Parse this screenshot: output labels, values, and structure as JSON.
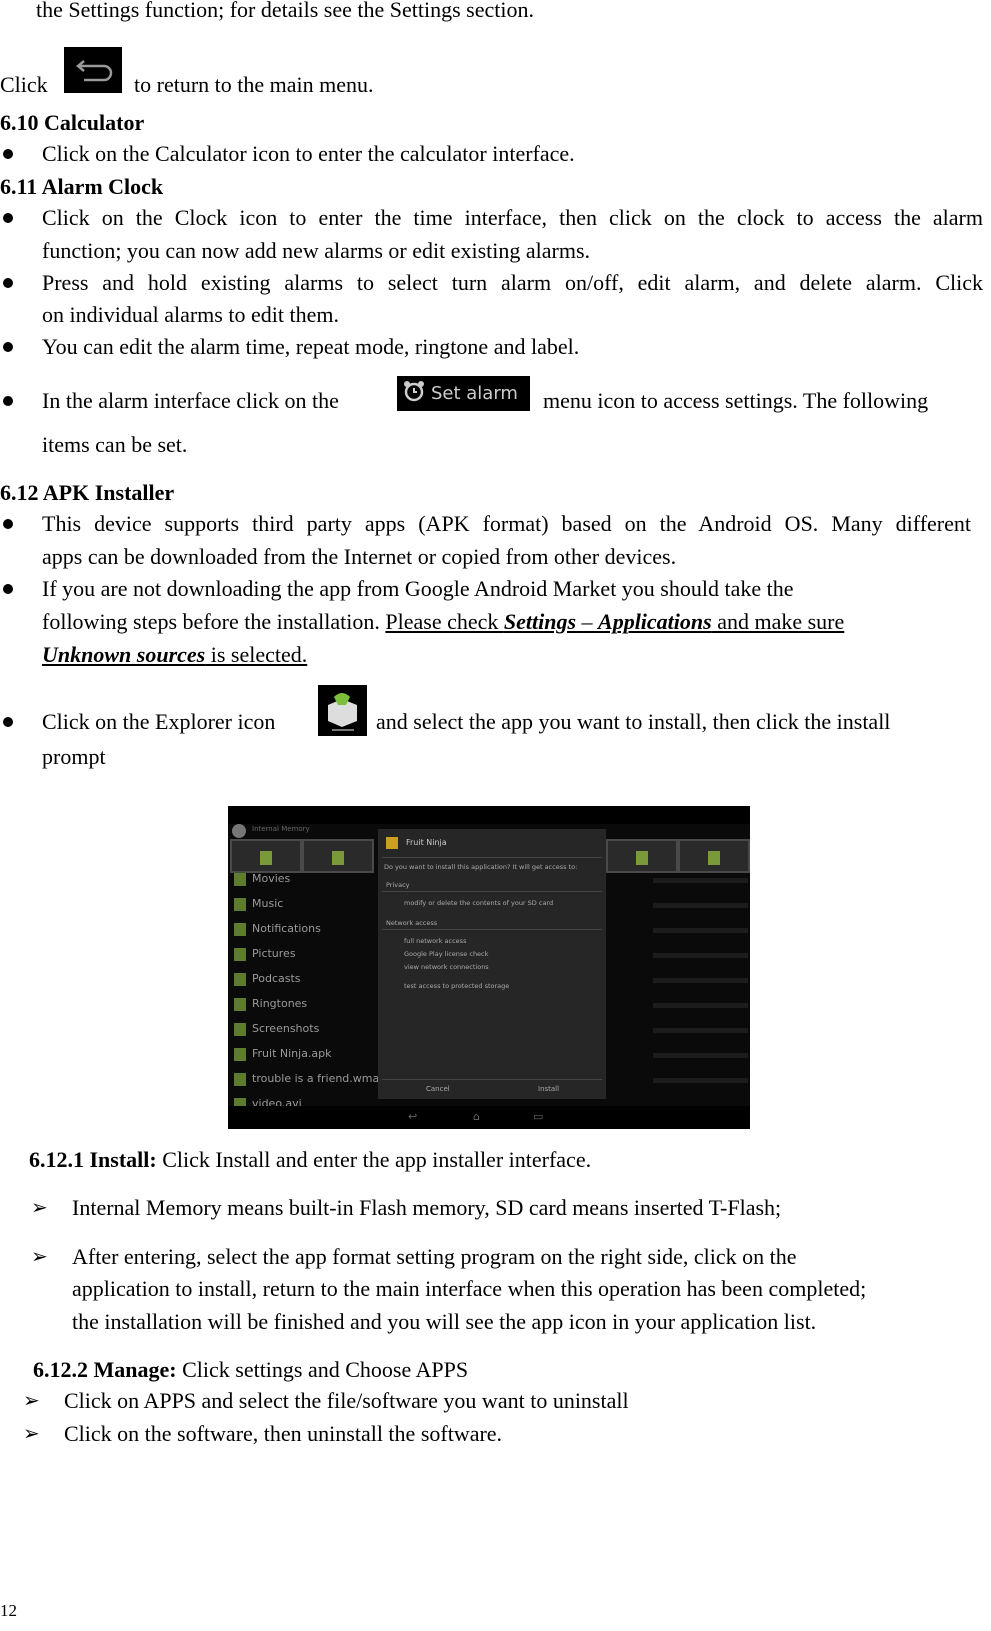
{
  "intro_line": "the Settings function; for details see the Settings section.",
  "back_line": {
    "before": "Click",
    "after": "to return to the main menu.",
    "icon": "back-arrow-icon"
  },
  "s610": {
    "heading": "6.10 Calculator",
    "bullets": [
      "Click on the Calculator icon to enter the calculator interface."
    ]
  },
  "s611": {
    "heading": "6.11 Alarm Clock",
    "b1": [
      "Click on the Clock icon to enter the time interface, then click on the clock to access the alarm",
      "function; you can now add new alarms or edit existing alarms."
    ],
    "b2": [
      "Press and hold existing alarms to select turn alarm on/off, edit alarm, and delete alarm. Click",
      "on individual alarms to edit them."
    ],
    "b3": "You can edit the alarm time, repeat mode, ringtone and label.",
    "b4": {
      "before": "In the alarm interface click on the",
      "after": "menu icon to access settings. The following",
      "line2": "items can be set.",
      "button_label": "Set alarm",
      "icon": "alarm-clock-icon"
    }
  },
  "s612": {
    "heading": "6.12 APK Installer",
    "b1": [
      "This device supports third party apps (APK format) based on the Android OS. Many different",
      "apps can be downloaded from the Internet or copied from other devices."
    ],
    "b2": {
      "line1": "If you are not downloading the app from Google Android Market you should take the",
      "line2_plain": "following steps before the installation. ",
      "u1": "Please check ",
      "settings": "Settings",
      "dash": " – ",
      "applications": "Applications",
      "u2": " and make sure ",
      "unknown": "Unknown sources",
      "u3": " is selected."
    },
    "b3": {
      "before": "Click on the Explorer icon",
      "after": "and select the app you want to install, then click the install",
      "line2": "prompt",
      "icon": "explorer-icon"
    }
  },
  "screenshot": {
    "header": "Internal Memory",
    "list": [
      "Movies",
      "Music",
      "Notifications",
      "Pictures",
      "Podcasts",
      "Ringtones",
      "Screenshots",
      "Fruit Ninja.apk",
      "trouble is a friend.wma",
      "video.avi"
    ],
    "dialog": {
      "app": "Fruit Ninja",
      "question": "Do you want to install this application? It will get access to:",
      "privacy": "Privacy",
      "p1": "modify or delete the contents of your SD card",
      "network": "Network access",
      "n1": "full network access",
      "n2": "Google Play license check",
      "n3": "view network connections",
      "n4": "test access to protected storage",
      "cancel": "Cancel",
      "install": "Install"
    }
  },
  "s6121": {
    "heading": "6.12.1 Install:",
    "text": " Click Install and enter the app installer interface.",
    "a1": "Internal Memory means built-in Flash memory, SD card means inserted T-Flash;",
    "a2": [
      "After entering, select the app format setting program on the right side, click on the",
      "application to install, return to the main interface when this operation has been completed;",
      "the installation will be finished and you will see the app icon in your application list."
    ]
  },
  "s6122": {
    "heading": "6.12.2 Manage:",
    "text": " Click settings and Choose APPS",
    "a1": "Click on APPS and select the file/software you want to uninstall",
    "a2": "Click on the software, then uninstall the software."
  },
  "page_number": "12"
}
